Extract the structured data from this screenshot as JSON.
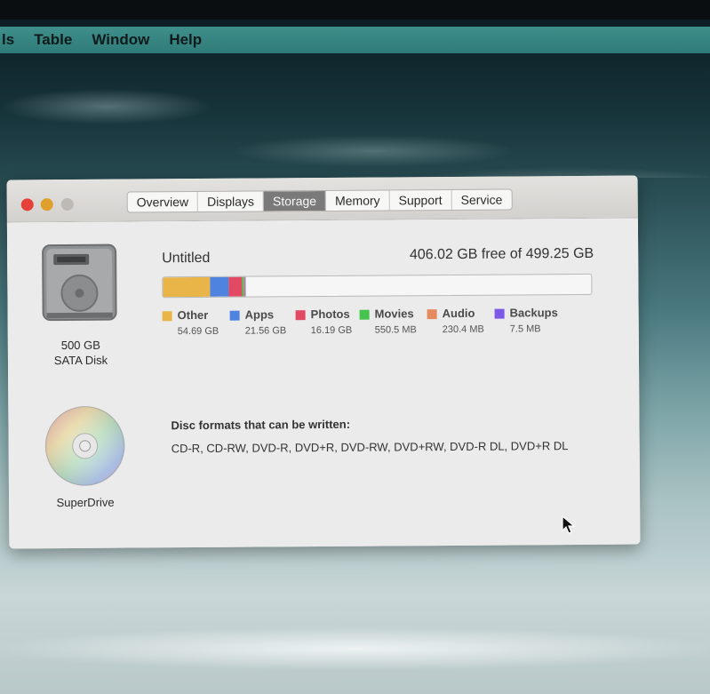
{
  "menubar": {
    "items": [
      "ls",
      "Table",
      "Window",
      "Help"
    ]
  },
  "window": {
    "tabs": [
      {
        "label": "Overview",
        "active": false
      },
      {
        "label": "Displays",
        "active": false
      },
      {
        "label": "Storage",
        "active": true
      },
      {
        "label": "Memory",
        "active": false
      },
      {
        "label": "Support",
        "active": false
      },
      {
        "label": "Service",
        "active": false
      }
    ],
    "disk": {
      "label_line1": "500 GB",
      "label_line2": "SATA Disk",
      "icon": "hard-disk-icon"
    },
    "drive": {
      "label": "SuperDrive",
      "icon": "dvd-disc-icon"
    },
    "volume": {
      "name": "Untitled",
      "free_text": "406.02 GB free of 499.25 GB",
      "free_gb": 406.02,
      "total_gb": 499.25
    },
    "storage": [
      {
        "name": "Other",
        "size": "54.69 GB",
        "gb": 54.69,
        "color": "#e9b548"
      },
      {
        "name": "Apps",
        "size": "21.56 GB",
        "gb": 21.56,
        "color": "#4f83e0"
      },
      {
        "name": "Photos",
        "size": "16.19 GB",
        "gb": 16.19,
        "color": "#e24a64"
      },
      {
        "name": "Movies",
        "size": "550.5 MB",
        "gb": 0.55,
        "color": "#46c24e"
      },
      {
        "name": "Audio",
        "size": "230.4 MB",
        "gb": 0.23,
        "color": "#e58a5e"
      },
      {
        "name": "Backups",
        "size": "7.5 MB",
        "gb": 0.0075,
        "color": "#7e58e6"
      }
    ],
    "disc": {
      "heading": "Disc formats that can be written:",
      "formats": "CD-R, CD-RW, DVD-R, DVD+R, DVD-RW, DVD+RW, DVD-R DL, DVD+R DL"
    }
  }
}
